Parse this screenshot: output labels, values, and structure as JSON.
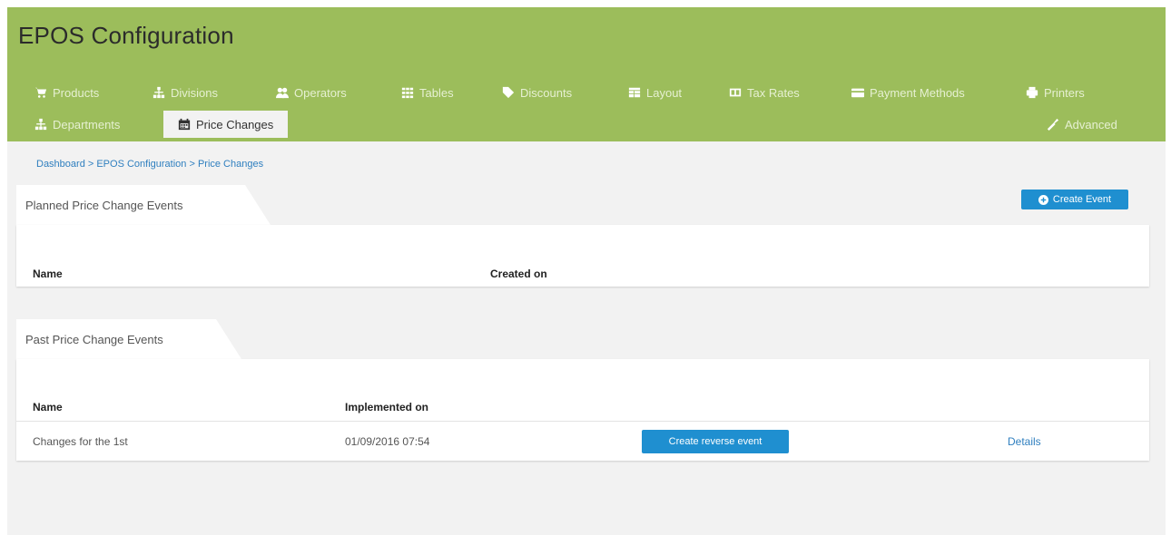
{
  "app": {
    "title": "EPOS Configuration"
  },
  "nav": {
    "row1": [
      {
        "label": "Products",
        "icon": "cart-icon"
      },
      {
        "label": "Divisions",
        "icon": "sitemap-icon"
      },
      {
        "label": "Operators",
        "icon": "users-icon"
      },
      {
        "label": "Tables",
        "icon": "grid-icon"
      },
      {
        "label": "Discounts",
        "icon": "tag-icon"
      },
      {
        "label": "Layout",
        "icon": "layout-icon"
      },
      {
        "label": "Tax Rates",
        "icon": "tax-icon"
      },
      {
        "label": "Payment Methods",
        "icon": "credit-card-icon"
      },
      {
        "label": "Printers",
        "icon": "printer-icon"
      }
    ],
    "row2": [
      {
        "label": "Departments",
        "icon": "sitemap-icon"
      },
      {
        "label": "Price Changes",
        "icon": "calendar-icon",
        "active": true
      },
      {
        "label": "Advanced",
        "icon": "wrench-icon"
      }
    ]
  },
  "breadcrumb": "Dashboard > EPOS Configuration > Price Changes",
  "planned": {
    "title": "Planned Price Change Events",
    "create_button": "Create Event",
    "columns": [
      "Name",
      "Created on"
    ]
  },
  "past": {
    "title": "Past Price Change Events",
    "columns": [
      "Name",
      "Implemented on"
    ],
    "rows": [
      {
        "name": "Changes for the 1st",
        "implemented_on": "01/09/2016 07:54",
        "action_label": "Create reverse event",
        "details_label": "Details"
      }
    ]
  },
  "colors": {
    "header": "#9cbd5b",
    "accent": "#1f8fd0",
    "link": "#2f7fbf",
    "background": "#f2f2f2"
  }
}
